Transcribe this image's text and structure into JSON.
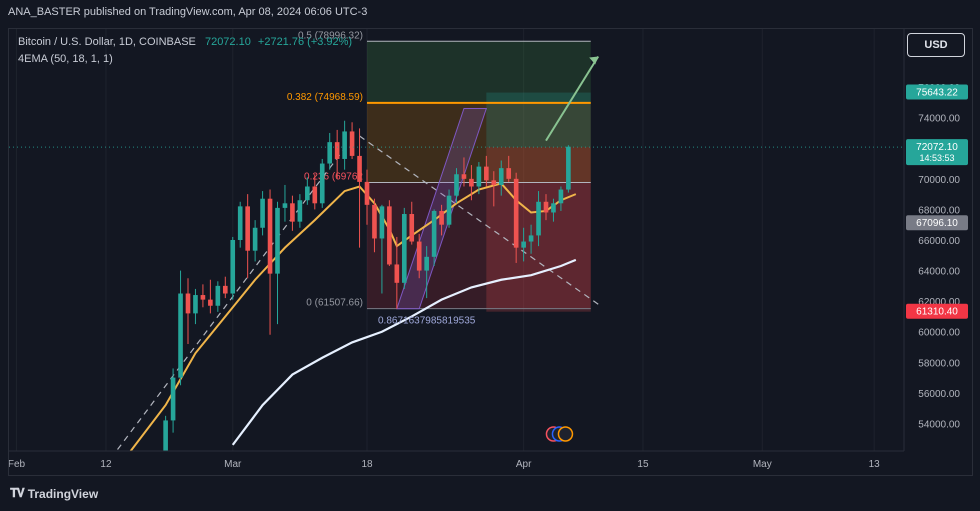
{
  "header": {
    "publish_line": "ANA_BASTER published on TradingView.com, Apr 08, 2024 06:06 UTC-3"
  },
  "legend": {
    "symbol": "Bitcoin / U.S. Dollar, 1D, COINBASE",
    "price": "72072.10",
    "change": "+2721.76 (+3.92%)",
    "indicator": "4EMA (50, 18, 1, 1)"
  },
  "currency_button": "USD",
  "footer": {
    "logo_text": "TradingView",
    "logo_icon": "tradingview-logo-icon"
  },
  "colors": {
    "background": "#131722",
    "up": "#26a69a",
    "down": "#ef5350",
    "ema_fast": "#f0b54a",
    "ema_slow": "#e6f0ff",
    "fib_orange": "#ff9800",
    "fib_red": "#f7525f",
    "projection_green": "#89c391",
    "channel_purple": "#7e57c2"
  },
  "chart_data": {
    "type": "candlestick",
    "instrument": "Bitcoin / U.S. Dollar",
    "timeframe": "1D",
    "exchange": "COINBASE",
    "y_axis_ticks": [
      54000,
      56000,
      58000,
      60000,
      62000,
      64000,
      66000,
      68000,
      70000,
      72000,
      74000,
      76000
    ],
    "y_axis_labels": [
      "54000.00",
      "56000.00",
      "58000.00",
      "60000.00",
      "62000.00",
      "64000.00",
      "66000.00",
      "68000.00",
      "70000.00",
      "72000.00",
      "74000.00",
      "76000.00"
    ],
    "ylim": [
      52200,
      79800
    ],
    "x_axis_labels": [
      "Feb",
      "12",
      "Mar",
      "18",
      "Apr",
      "15",
      "May",
      "13"
    ],
    "x_axis_positions": [
      0,
      12,
      29,
      47,
      68,
      84,
      100,
      115
    ],
    "xlim": [
      -1,
      119
    ],
    "price_tags": [
      {
        "value": "75643.22",
        "price": 75643,
        "style": "green"
      },
      {
        "value": "72072.10",
        "price": 72072,
        "style": "green",
        "sub": "14:53:53"
      },
      {
        "value": "67096.10",
        "price": 67096,
        "style": "grey"
      },
      {
        "value": "61310.40",
        "price": 61310,
        "style": "red"
      }
    ],
    "fib_levels": [
      {
        "label": "0.5 (78996.32)",
        "price": 78996
      },
      {
        "label": "0.382 (74968.59)",
        "price": 74969
      },
      {
        "label": "0.236 (69762",
        "price": 69762
      },
      {
        "label": "0 (61507.66)",
        "price": 61508
      }
    ],
    "position_label": "0.8671637985819535",
    "candles": [
      {
        "d": 20,
        "o": 52000,
        "h": 54500,
        "l": 51300,
        "c": 54200
      },
      {
        "d": 21,
        "o": 54200,
        "h": 57600,
        "l": 53400,
        "c": 57000
      },
      {
        "d": 22,
        "o": 57000,
        "h": 64000,
        "l": 56500,
        "c": 62500
      },
      {
        "d": 23,
        "o": 62500,
        "h": 63500,
        "l": 59200,
        "c": 61200
      },
      {
        "d": 24,
        "o": 61200,
        "h": 62800,
        "l": 60500,
        "c": 62400
      },
      {
        "d": 25,
        "o": 62400,
        "h": 63100,
        "l": 61600,
        "c": 62100
      },
      {
        "d": 26,
        "o": 62100,
        "h": 63400,
        "l": 61200,
        "c": 61700
      },
      {
        "d": 27,
        "o": 61700,
        "h": 63300,
        "l": 61300,
        "c": 63000
      },
      {
        "d": 28,
        "o": 63000,
        "h": 63600,
        "l": 62200,
        "c": 62500
      },
      {
        "d": 29,
        "o": 62500,
        "h": 66200,
        "l": 62100,
        "c": 66000
      },
      {
        "d": 30,
        "o": 66000,
        "h": 68500,
        "l": 65500,
        "c": 68200
      },
      {
        "d": 31,
        "o": 68200,
        "h": 69000,
        "l": 63500,
        "c": 65300
      },
      {
        "d": 32,
        "o": 65300,
        "h": 67300,
        "l": 64600,
        "c": 66800
      },
      {
        "d": 33,
        "o": 66800,
        "h": 69200,
        "l": 66300,
        "c": 68700
      },
      {
        "d": 34,
        "o": 68700,
        "h": 69300,
        "l": 59800,
        "c": 63800
      },
      {
        "d": 35,
        "o": 63800,
        "h": 68500,
        "l": 60500,
        "c": 68100
      },
      {
        "d": 36,
        "o": 68100,
        "h": 69600,
        "l": 67200,
        "c": 68400
      },
      {
        "d": 37,
        "o": 68400,
        "h": 68900,
        "l": 66600,
        "c": 67200
      },
      {
        "d": 38,
        "o": 67200,
        "h": 69000,
        "l": 66800,
        "c": 68600
      },
      {
        "d": 39,
        "o": 68600,
        "h": 70100,
        "l": 68300,
        "c": 69500
      },
      {
        "d": 40,
        "o": 69500,
        "h": 70300,
        "l": 68000,
        "c": 68400
      },
      {
        "d": 41,
        "o": 68400,
        "h": 71300,
        "l": 68100,
        "c": 71000
      },
      {
        "d": 42,
        "o": 71000,
        "h": 73000,
        "l": 70600,
        "c": 72400
      },
      {
        "d": 43,
        "o": 72400,
        "h": 73200,
        "l": 70000,
        "c": 71300
      },
      {
        "d": 44,
        "o": 71300,
        "h": 73800,
        "l": 70600,
        "c": 73100
      },
      {
        "d": 45,
        "o": 73100,
        "h": 73700,
        "l": 71300,
        "c": 71500
      },
      {
        "d": 46,
        "o": 71500,
        "h": 73300,
        "l": 65500,
        "c": 69800
      },
      {
        "d": 47,
        "o": 69800,
        "h": 70600,
        "l": 67000,
        "c": 68300
      },
      {
        "d": 48,
        "o": 68300,
        "h": 68700,
        "l": 65200,
        "c": 66100
      },
      {
        "d": 49,
        "o": 66100,
        "h": 68300,
        "l": 62500,
        "c": 68200
      },
      {
        "d": 50,
        "o": 68200,
        "h": 68600,
        "l": 64300,
        "c": 64400
      },
      {
        "d": 51,
        "o": 64400,
        "h": 66200,
        "l": 61500,
        "c": 63200
      },
      {
        "d": 52,
        "o": 63200,
        "h": 68100,
        "l": 62800,
        "c": 67700
      },
      {
        "d": 53,
        "o": 67700,
        "h": 68500,
        "l": 65700,
        "c": 65900
      },
      {
        "d": 54,
        "o": 65900,
        "h": 66400,
        "l": 63500,
        "c": 64000
      },
      {
        "d": 55,
        "o": 64000,
        "h": 65600,
        "l": 62200,
        "c": 64900
      },
      {
        "d": 56,
        "o": 64900,
        "h": 68000,
        "l": 64300,
        "c": 67900
      },
      {
        "d": 57,
        "o": 67900,
        "h": 68300,
        "l": 66300,
        "c": 67000
      },
      {
        "d": 58,
        "o": 67000,
        "h": 69300,
        "l": 66800,
        "c": 68900
      },
      {
        "d": 59,
        "o": 68900,
        "h": 70700,
        "l": 68400,
        "c": 70300
      },
      {
        "d": 60,
        "o": 70300,
        "h": 71400,
        "l": 69500,
        "c": 70000
      },
      {
        "d": 61,
        "o": 70000,
        "h": 70900,
        "l": 68600,
        "c": 69500
      },
      {
        "d": 62,
        "o": 69500,
        "h": 71100,
        "l": 69000,
        "c": 70800
      },
      {
        "d": 63,
        "o": 70800,
        "h": 71500,
        "l": 69500,
        "c": 69900
      },
      {
        "d": 64,
        "o": 69900,
        "h": 70500,
        "l": 68200,
        "c": 69600
      },
      {
        "d": 65,
        "o": 69600,
        "h": 71200,
        "l": 68900,
        "c": 70700
      },
      {
        "d": 66,
        "o": 70700,
        "h": 71500,
        "l": 69800,
        "c": 70000
      },
      {
        "d": 67,
        "o": 70000,
        "h": 70400,
        "l": 64500,
        "c": 65500
      },
      {
        "d": 68,
        "o": 65500,
        "h": 66800,
        "l": 64600,
        "c": 65900
      },
      {
        "d": 69,
        "o": 65900,
        "h": 67000,
        "l": 65100,
        "c": 66300
      },
      {
        "d": 70,
        "o": 66300,
        "h": 69200,
        "l": 65600,
        "c": 68500
      },
      {
        "d": 71,
        "o": 68500,
        "h": 69000,
        "l": 67300,
        "c": 67800
      },
      {
        "d": 72,
        "o": 67800,
        "h": 68700,
        "l": 67200,
        "c": 68400
      },
      {
        "d": 73,
        "o": 68400,
        "h": 69500,
        "l": 67900,
        "c": 69300
      },
      {
        "d": 74,
        "o": 69300,
        "h": 72200,
        "l": 69100,
        "c": 72100
      }
    ],
    "ema_fast": [
      [
        15,
        52000
      ],
      [
        20,
        55200
      ],
      [
        24,
        58600
      ],
      [
        28,
        61000
      ],
      [
        32,
        63400
      ],
      [
        36,
        65500
      ],
      [
        40,
        67300
      ],
      [
        44,
        69200
      ],
      [
        46,
        69500
      ],
      [
        48,
        68400
      ],
      [
        50,
        66700
      ],
      [
        51,
        65600
      ],
      [
        53,
        66300
      ],
      [
        56,
        67300
      ],
      [
        59,
        68400
      ],
      [
        62,
        69300
      ],
      [
        65,
        69700
      ],
      [
        67,
        68600
      ],
      [
        69,
        67800
      ],
      [
        71,
        67900
      ],
      [
        73,
        68600
      ],
      [
        75,
        69000
      ]
    ],
    "ema_slow": [
      [
        29,
        52600
      ],
      [
        33,
        55200
      ],
      [
        37,
        57200
      ],
      [
        41,
        58300
      ],
      [
        45,
        59300
      ],
      [
        49,
        60000
      ],
      [
        53,
        61000
      ],
      [
        57,
        62100
      ],
      [
        61,
        62900
      ],
      [
        65,
        63400
      ],
      [
        69,
        63700
      ],
      [
        73,
        64300
      ],
      [
        75,
        64700
      ]
    ]
  }
}
